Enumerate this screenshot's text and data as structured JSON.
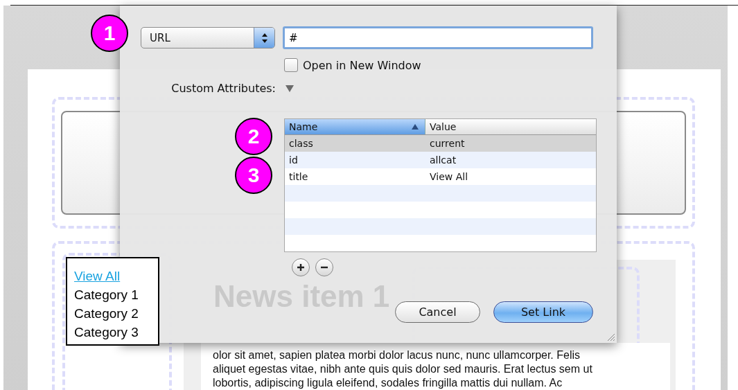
{
  "dialog": {
    "link_type": "URL",
    "url": "#",
    "open_in_new_window": {
      "label": "Open in New Window",
      "checked": false
    },
    "custom_attributes": {
      "label": "Custom Attributes:",
      "expanded": true
    },
    "table": {
      "columns": [
        {
          "label": "Name",
          "sorted": true
        },
        {
          "label": "Value",
          "sorted": false
        }
      ],
      "rows": [
        {
          "name": "class",
          "value": "current",
          "selected": true
        },
        {
          "name": "id",
          "value": "allcat",
          "selected": false
        },
        {
          "name": "title",
          "value": "View All",
          "selected": false
        }
      ]
    },
    "buttons": [
      {
        "label": "Cancel",
        "kind": "secondary"
      },
      {
        "label": "Set Link",
        "kind": "primary"
      }
    ]
  },
  "callouts": [
    "1",
    "2",
    "3"
  ],
  "category_menu": [
    {
      "label": "View All",
      "kind": "link"
    },
    {
      "label": "Category 1",
      "kind": "plain"
    },
    {
      "label": "Category 2",
      "kind": "plain"
    },
    {
      "label": "Category 3",
      "kind": "plain"
    }
  ],
  "news": {
    "title": "News item 1",
    "body_lines": [
      "olor sit amet, sapien platea morbi dolor lacus nunc, nunc ullamcorper. Felis",
      "aliquet egestas vitae, nibh ante quis quis dolor sed mauris. Erat lectus sem ut",
      "lobortis, adipiscing ligula eleifend, sodales fringilla mattis dui nullam. Ac"
    ]
  }
}
